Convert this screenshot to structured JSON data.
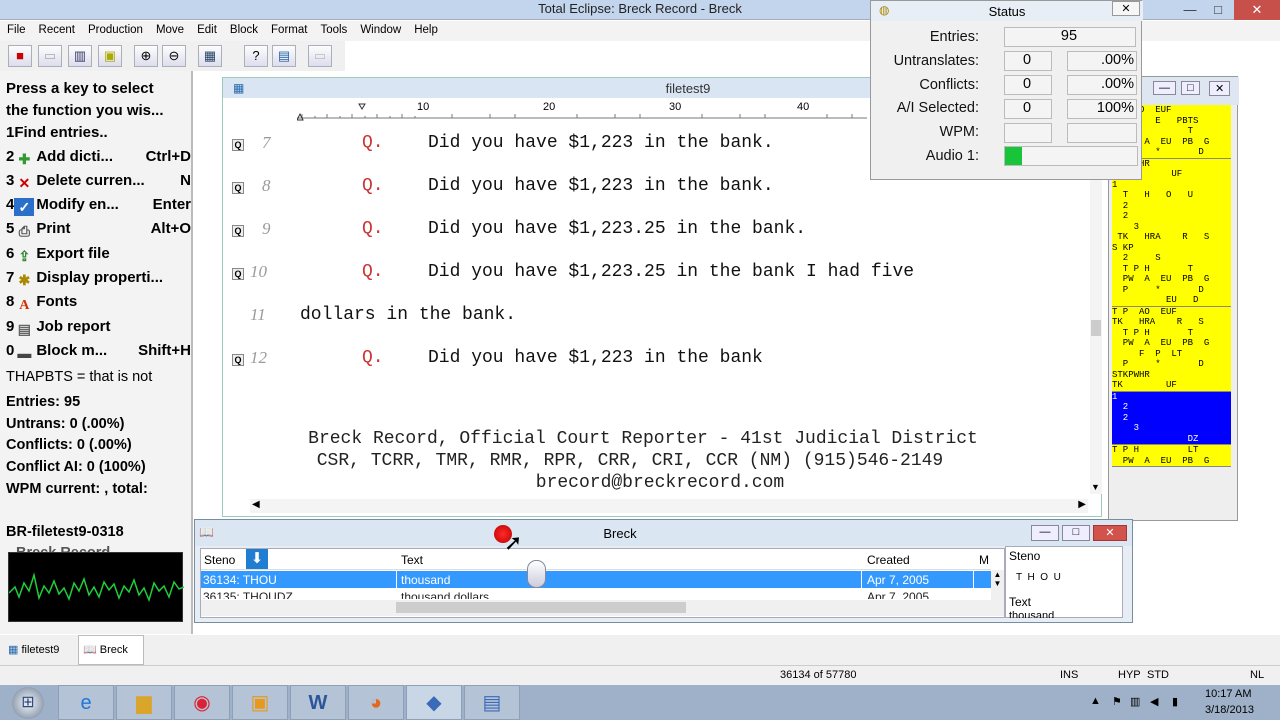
{
  "window": {
    "title": "Total Eclipse: Breck Record - Breck"
  },
  "menu": [
    "File",
    "Recent",
    "Production",
    "Move",
    "Edit",
    "Block",
    "Format",
    "Tools",
    "Window",
    "Help"
  ],
  "toolbar": {
    "icons": [
      "stop-icon",
      "page-icon",
      "columns-icon",
      "note-icon",
      "zoom-in-icon",
      "zoom-out-icon",
      "image-icon",
      "help-icon",
      "document-icon",
      "blank-icon"
    ]
  },
  "left_panel": {
    "prompt_line1": "Press a key to select",
    "prompt_line2": "the function you wis...",
    "functions": [
      {
        "num": "1",
        "label": "Find entries..",
        "key": ""
      },
      {
        "num": "2",
        "label": "Add dicti...",
        "key": "Ctrl+D"
      },
      {
        "num": "3",
        "label": "Delete curren...",
        "key": "N"
      },
      {
        "num": "4",
        "label": "Modify en...",
        "key": "Enter"
      },
      {
        "num": "5",
        "label": "Print",
        "key": "Alt+O"
      },
      {
        "num": "6",
        "label": "Export file",
        "key": ""
      },
      {
        "num": "7",
        "label": "Display properti...",
        "key": ""
      },
      {
        "num": "8",
        "label": "Fonts",
        "key": ""
      },
      {
        "num": "9",
        "label": "Job report",
        "key": ""
      },
      {
        "num": "0",
        "label": "Block m...",
        "key": "Shift+H"
      }
    ],
    "definition": "THAPBTS = that is not",
    "stats": [
      "Entries: 95",
      "Untrans: 0 (.00%)",
      "Conflicts: 0 (.00%)",
      "Conflict AI: 0 (100%)",
      "WPM current: , total:"
    ],
    "job_name": "BR-filetest9-0318",
    "job_name_partial": "Breck Record"
  },
  "editor": {
    "title": "filetest9",
    "ruler_ticks": [
      "10",
      "20",
      "30",
      "40"
    ],
    "lines": [
      {
        "num": "7",
        "q": true,
        "speaker": "Q.",
        "text": "Did you have $1,223 in the bank."
      },
      {
        "num": "8",
        "q": true,
        "speaker": "Q.",
        "text": "Did you have $1,223 in the bank."
      },
      {
        "num": "9",
        "q": true,
        "speaker": "Q.",
        "text": "Did you have $1,223.25 in the bank."
      },
      {
        "num": "10",
        "q": true,
        "speaker": "Q.",
        "text": "Did you have $1,223.25 in the bank I had five"
      },
      {
        "num": "11",
        "q": false,
        "speaker": "",
        "text": "dollars in the bank."
      },
      {
        "num": "12",
        "q": true,
        "speaker": "Q.",
        "text": "Did you have $1,223 in the bank"
      }
    ],
    "footer": [
      "Breck Record, Official Court Reporter - 41st Judicial District",
      "CSR, TCRR, TMR, RMR, RPR, CRR, CRI, CCR (NM) (915)546-2149",
      "brecord@breckrecord.com"
    ]
  },
  "steno_pane": {
    "blocks": [
      {
        "bg": "#ffff00",
        "lines": [
          "    AO  EUF",
          "        E   PBTS",
          "              T",
          "  PW  A  EU  PB  G",
          "  P     *       D"
        ]
      },
      {
        "bg": "#ffff00",
        "lines": [
          "STKPWHR",
          " TK        UF",
          "1",
          "  T   H   O   U",
          "  2",
          "  2",
          "    3",
          " TK   HRA    R   S",
          "S KP",
          "  2     S",
          "  T P H       T",
          "  PW  A  EU  PB  G",
          "  P     *       D",
          "          EU   D"
        ]
      },
      {
        "bg": "#ffff00",
        "lines": [
          "T P  AO  EUF",
          "TK   HRA    R   S",
          "  T P H       T",
          "  PW  A  EU  PB  G",
          "     F  P  LT",
          "  P     *       D",
          "STKPWHR",
          "TK        UF"
        ]
      },
      {
        "bg": "#0000ff",
        "lines": [
          "1",
          "  2",
          "  2",
          "    3",
          "              DZ"
        ]
      },
      {
        "bg": "#ffff00",
        "lines": [
          "T P H         LT",
          "  PW  A  EU  PB  G"
        ]
      }
    ]
  },
  "status_window": {
    "title": "Status",
    "rows": [
      {
        "label": "Entries:",
        "v1": "95",
        "v2": ""
      },
      {
        "label": "Untranslates:",
        "v1": "0",
        "v2": ".00%"
      },
      {
        "label": "Conflicts:",
        "v1": "0",
        "v2": ".00%"
      },
      {
        "label": "A/I Selected:",
        "v1": "0",
        "v2": "100%"
      },
      {
        "label": "WPM:",
        "v1": "",
        "v2": ""
      },
      {
        "label": "Audio 1:",
        "v1": "",
        "v2": ""
      }
    ],
    "audio_level": 0.13
  },
  "breck_window": {
    "title": "Breck",
    "columns": [
      "Steno",
      "Text",
      "Created",
      "M"
    ],
    "rows": [
      {
        "steno": "36134: THOU",
        "text": "thousand",
        "created": "Apr 7, 2005",
        "selected": true
      },
      {
        "steno": "36135: THOUDZ",
        "text": "thousand dollars",
        "created": "Apr 7, 2005",
        "selected": false
      }
    ],
    "side_steno_label": "Steno",
    "side_steno_value": "T  H  O  U",
    "side_text_label": "Text",
    "side_text_value": "thousand"
  },
  "tabs": [
    {
      "label": "filetest9"
    },
    {
      "label": "Breck"
    }
  ],
  "statusbar": {
    "record": "36134 of 57780",
    "ins": "INS",
    "hyp": "HYP",
    "std": "STD",
    "nl": "NL"
  },
  "taskbar": {
    "apps": [
      "ie-icon",
      "explorer-icon",
      "chrome-icon",
      "outlook-icon",
      "word-icon",
      "firefox-icon",
      "eclipse-icon",
      "video-icon"
    ],
    "time": "10:17 AM",
    "date": "3/18/2013"
  }
}
